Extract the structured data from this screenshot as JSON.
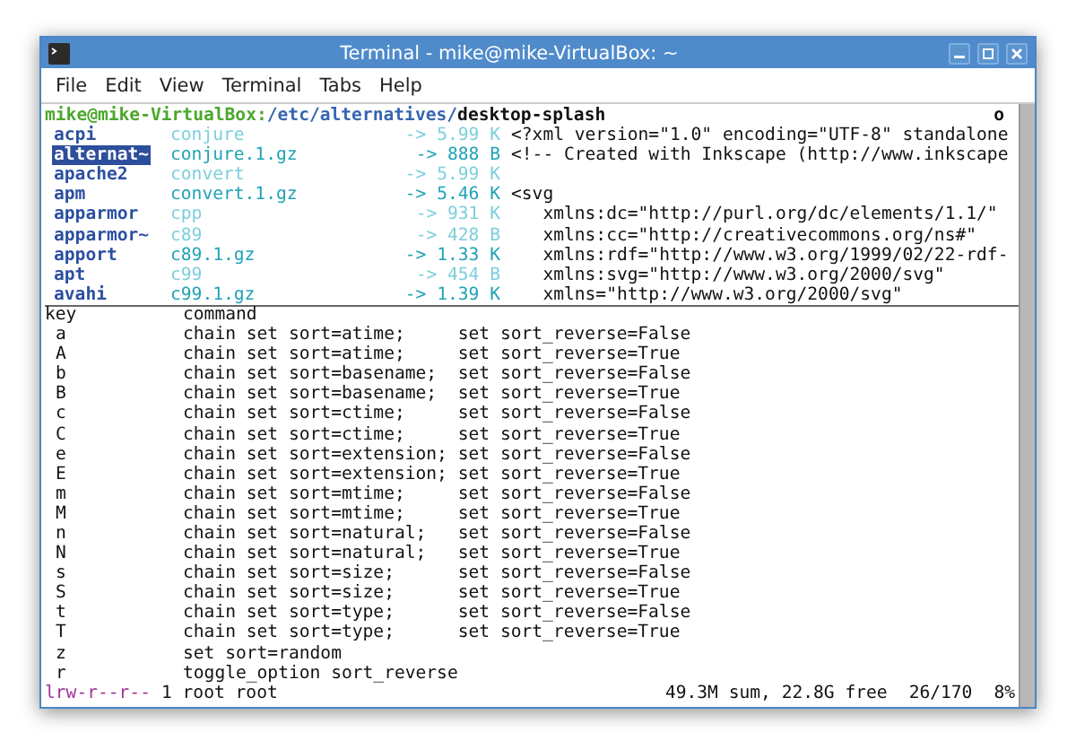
{
  "window": {
    "title": "Terminal - mike@mike-VirtualBox: ~"
  },
  "menu": [
    "File",
    "Edit",
    "View",
    "Terminal",
    "Tabs",
    "Help"
  ],
  "prompt": {
    "user_host": "mike@mike-VirtualBox:",
    "path": "/etc/alternatives/",
    "file": "desktop-splash",
    "flags": "o"
  },
  "parent_column": [
    {
      "name": "acpi",
      "selected": false
    },
    {
      "name": "alternat~",
      "selected": true
    },
    {
      "name": "apache2",
      "selected": false
    },
    {
      "name": "apm",
      "selected": false
    },
    {
      "name": "apparmor",
      "selected": false
    },
    {
      "name": "apparmor~",
      "selected": false
    },
    {
      "name": "apport",
      "selected": false
    },
    {
      "name": "apt",
      "selected": false
    },
    {
      "name": "avahi",
      "selected": false
    }
  ],
  "files": [
    {
      "name": "conjure",
      "size": "-> 5.99 K",
      "color": "#7ccfdc"
    },
    {
      "name": "conjure.1.gz",
      "size": "-> 888 B",
      "color": "#1fa3b5"
    },
    {
      "name": "convert",
      "size": "-> 5.99 K",
      "color": "#7ccfdc"
    },
    {
      "name": "convert.1.gz",
      "size": "-> 5.46 K",
      "color": "#1fa3b5"
    },
    {
      "name": "cpp",
      "size": "-> 931 K",
      "color": "#7ccfdc"
    },
    {
      "name": "c89",
      "size": "-> 428 B",
      "color": "#7ccfdc"
    },
    {
      "name": "c89.1.gz",
      "size": "-> 1.33 K",
      "color": "#1fa3b5"
    },
    {
      "name": "c99",
      "size": "-> 454 B",
      "color": "#7ccfdc"
    },
    {
      "name": "c99.1.gz",
      "size": "-> 1.39 K",
      "color": "#1fa3b5"
    }
  ],
  "preview": [
    [
      "<?xml version=\"1.0\" encoding=\"UTF-8\" standalone",
      "<!-- Created with Inkscape (http://www.inkscape"
    ],
    [
      "<svg",
      "   xmlns:dc=\"http://purl.org/dc/elements/1.1/\"",
      "   xmlns:cc=\"http://creativecommons.org/ns#\"",
      "   xmlns:rdf=\"http://www.w3.org/1999/02/22-rdf-",
      "   xmlns:svg=\"http://www.w3.org/2000/svg\"",
      "   xmlns=\"http://www.w3.org/2000/svg\""
    ]
  ],
  "bindings": {
    "columns": [
      "key",
      "command"
    ],
    "rows": [
      [
        "a",
        "chain set sort=atime;     set sort_reverse=False"
      ],
      [
        "A",
        "chain set sort=atime;     set sort_reverse=True"
      ],
      [
        "b",
        "chain set sort=basename;  set sort_reverse=False"
      ],
      [
        "B",
        "chain set sort=basename;  set sort_reverse=True"
      ],
      [
        "c",
        "chain set sort=ctime;     set sort_reverse=False"
      ],
      [
        "C",
        "chain set sort=ctime;     set sort_reverse=True"
      ],
      [
        "e",
        "chain set sort=extension; set sort_reverse=False"
      ],
      [
        "E",
        "chain set sort=extension; set sort_reverse=True"
      ],
      [
        "m",
        "chain set sort=mtime;     set sort_reverse=False"
      ],
      [
        "M",
        "chain set sort=mtime;     set sort_reverse=True"
      ],
      [
        "n",
        "chain set sort=natural;   set sort_reverse=False"
      ],
      [
        "N",
        "chain set sort=natural;   set sort_reverse=True"
      ],
      [
        "s",
        "chain set sort=size;      set sort_reverse=False"
      ],
      [
        "S",
        "chain set sort=size;      set sort_reverse=True"
      ],
      [
        "t",
        "chain set sort=type;      set sort_reverse=False"
      ],
      [
        "T",
        "chain set sort=type;      set sort_reverse=True"
      ],
      [
        "z",
        "set sort=random"
      ],
      [
        "r",
        "toggle_option sort_reverse"
      ]
    ]
  },
  "status_bar": {
    "permissions": "lrw-r--r--",
    "owner": "1 root root",
    "usage": "49.3M sum, 22.8G free",
    "position": "26/170",
    "percent": "8%"
  }
}
